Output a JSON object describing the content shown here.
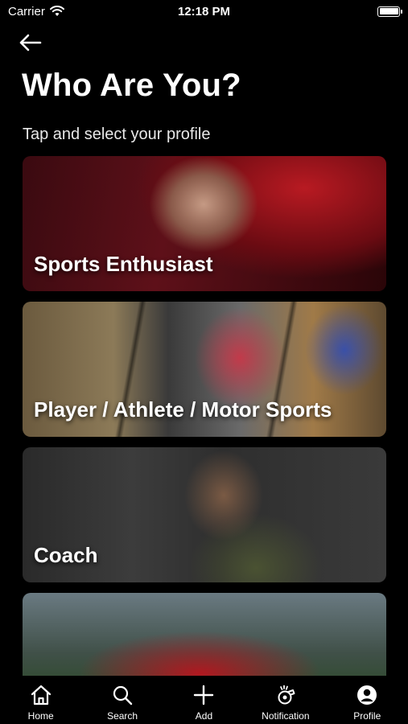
{
  "status_bar": {
    "carrier": "Carrier",
    "time": "12:18 PM"
  },
  "header": {
    "title": "Who Are You?",
    "subtitle": "Tap and select your profile"
  },
  "cards": [
    {
      "label": "Sports Enthusiast"
    },
    {
      "label": "Player / Athlete / Motor Sports"
    },
    {
      "label": "Coach"
    },
    {
      "label": ""
    }
  ],
  "tab_bar": {
    "items": [
      {
        "label": "Home",
        "icon": "home-icon"
      },
      {
        "label": "Search",
        "icon": "search-icon"
      },
      {
        "label": "Add",
        "icon": "plus-icon"
      },
      {
        "label": "Notification",
        "icon": "whistle-icon"
      },
      {
        "label": "Profile",
        "icon": "profile-icon"
      }
    ]
  },
  "colors": {
    "background": "#000000",
    "text": "#ffffff"
  }
}
